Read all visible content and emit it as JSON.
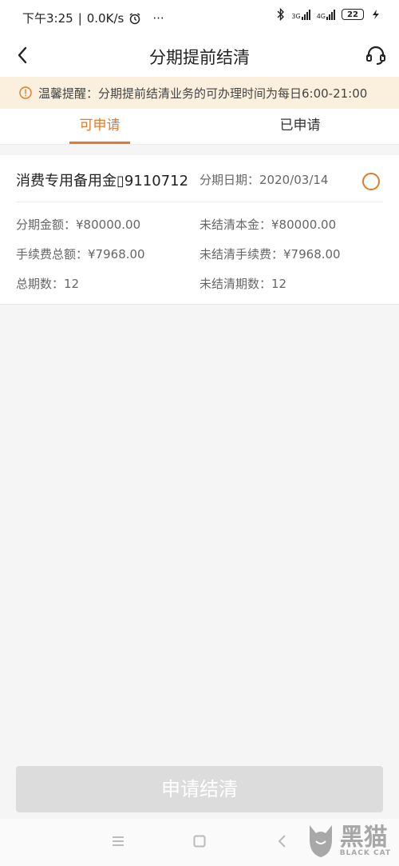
{
  "status_bar": {
    "time_label": "下午3:25",
    "speed": "0.0K/s",
    "more": "···",
    "net_3g": "3G",
    "net_4g": "4G",
    "battery": "22"
  },
  "header": {
    "title": "分期提前结清"
  },
  "notice": {
    "text": "温馨提醒：分期提前结清业务的可办理时间为每日6:00-21:00"
  },
  "tabs": [
    {
      "label": "可申请",
      "active": true
    },
    {
      "label": "已申请",
      "active": false
    }
  ],
  "record": {
    "title": "消费专用备用金▯9110712",
    "date_label": "分期日期：",
    "date_value": "2020/03/14",
    "amount_label": "分期金额：",
    "amount_value": "¥80000.00",
    "unpaid_principal_label": "未结清本金：",
    "unpaid_principal_value": "¥80000.00",
    "fee_total_label": "手续费总额：",
    "fee_total_value": "¥7968.00",
    "unpaid_fee_label": "未结清手续费：",
    "unpaid_fee_value": "¥7968.00",
    "periods_label": "总期数：",
    "periods_value": "12",
    "unpaid_periods_label": "未结清期数：",
    "unpaid_periods_value": "12"
  },
  "submit": {
    "label": "申请结清"
  },
  "watermark": {
    "cn": "黑猫",
    "en": "BLACK CAT"
  },
  "colors": {
    "accent": "#e07b2c",
    "notice_bg": "#fbf0dd",
    "disabled_button": "#dcdcdc"
  },
  "icons": [
    "alarm-icon",
    "bluetooth-icon",
    "signal-icon",
    "charging-icon",
    "back-arrow-icon",
    "customer-service-icon",
    "info-icon",
    "radio-icon",
    "menu-icon",
    "home-icon",
    "back-icon"
  ]
}
